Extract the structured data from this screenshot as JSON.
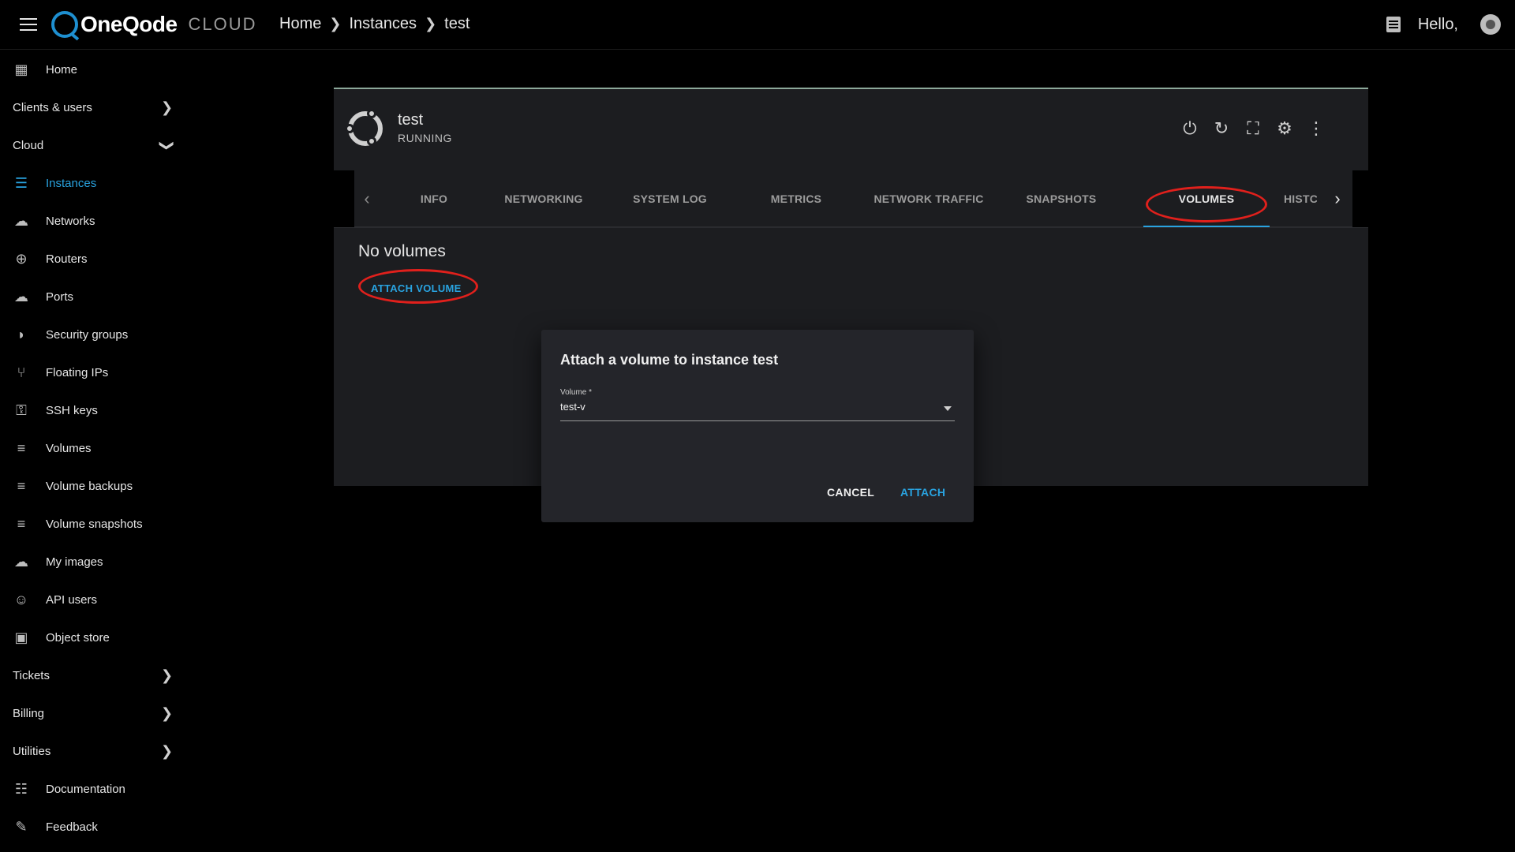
{
  "header": {
    "logo_text": "OneQode",
    "logo_sub": "CLOUD",
    "breadcrumb": [
      "Home",
      "Instances",
      "test"
    ],
    "greeting": "Hello,"
  },
  "sidebar": {
    "items": [
      {
        "label": "Home",
        "icon": "dashboard-icon"
      },
      {
        "label": "Clients & users",
        "chevron": ">"
      },
      {
        "label": "Cloud",
        "chevron": "v"
      },
      {
        "label": "Instances",
        "icon": "server-icon"
      },
      {
        "label": "Networks",
        "icon": "cloud-network-icon"
      },
      {
        "label": "Routers",
        "icon": "router-icon"
      },
      {
        "label": "Ports",
        "icon": "ports-icon"
      },
      {
        "label": "Security groups",
        "icon": "shield-icon"
      },
      {
        "label": "Floating IPs",
        "icon": "fork-icon"
      },
      {
        "label": "SSH keys",
        "icon": "key-icon"
      },
      {
        "label": "Volumes",
        "icon": "database-icon"
      },
      {
        "label": "Volume backups",
        "icon": "database-icon"
      },
      {
        "label": "Volume snapshots",
        "icon": "database-icon"
      },
      {
        "label": "My images",
        "icon": "cloud-upload-icon"
      },
      {
        "label": "API users",
        "icon": "users-icon"
      },
      {
        "label": "Object store",
        "icon": "images-icon"
      },
      {
        "label": "Tickets",
        "chevron": ">"
      },
      {
        "label": "Billing",
        "chevron": ">"
      },
      {
        "label": "Utilities",
        "chevron": ">"
      },
      {
        "label": "Documentation",
        "icon": "document-icon"
      },
      {
        "label": "Feedback",
        "icon": "feedback-icon"
      }
    ]
  },
  "instance": {
    "name": "test",
    "state": "RUNNING"
  },
  "tabs": [
    "INFO",
    "NETWORKING",
    "SYSTEM LOG",
    "METRICS",
    "NETWORK TRAFFIC",
    "SNAPSHOTS",
    "VOLUMES",
    "HISTC"
  ],
  "volumes": {
    "empty_text": "No volumes",
    "attach_label": "ATTACH VOLUME"
  },
  "dialog": {
    "title": "Attach a volume to instance test",
    "field_label": "Volume *",
    "field_value": "test-v",
    "cancel": "CANCEL",
    "attach": "ATTACH"
  },
  "colors": {
    "accent": "#29a3e0",
    "highlight_ring": "#e0201c",
    "card_bg": "#1c1d20",
    "dialog_bg": "#24252a"
  }
}
